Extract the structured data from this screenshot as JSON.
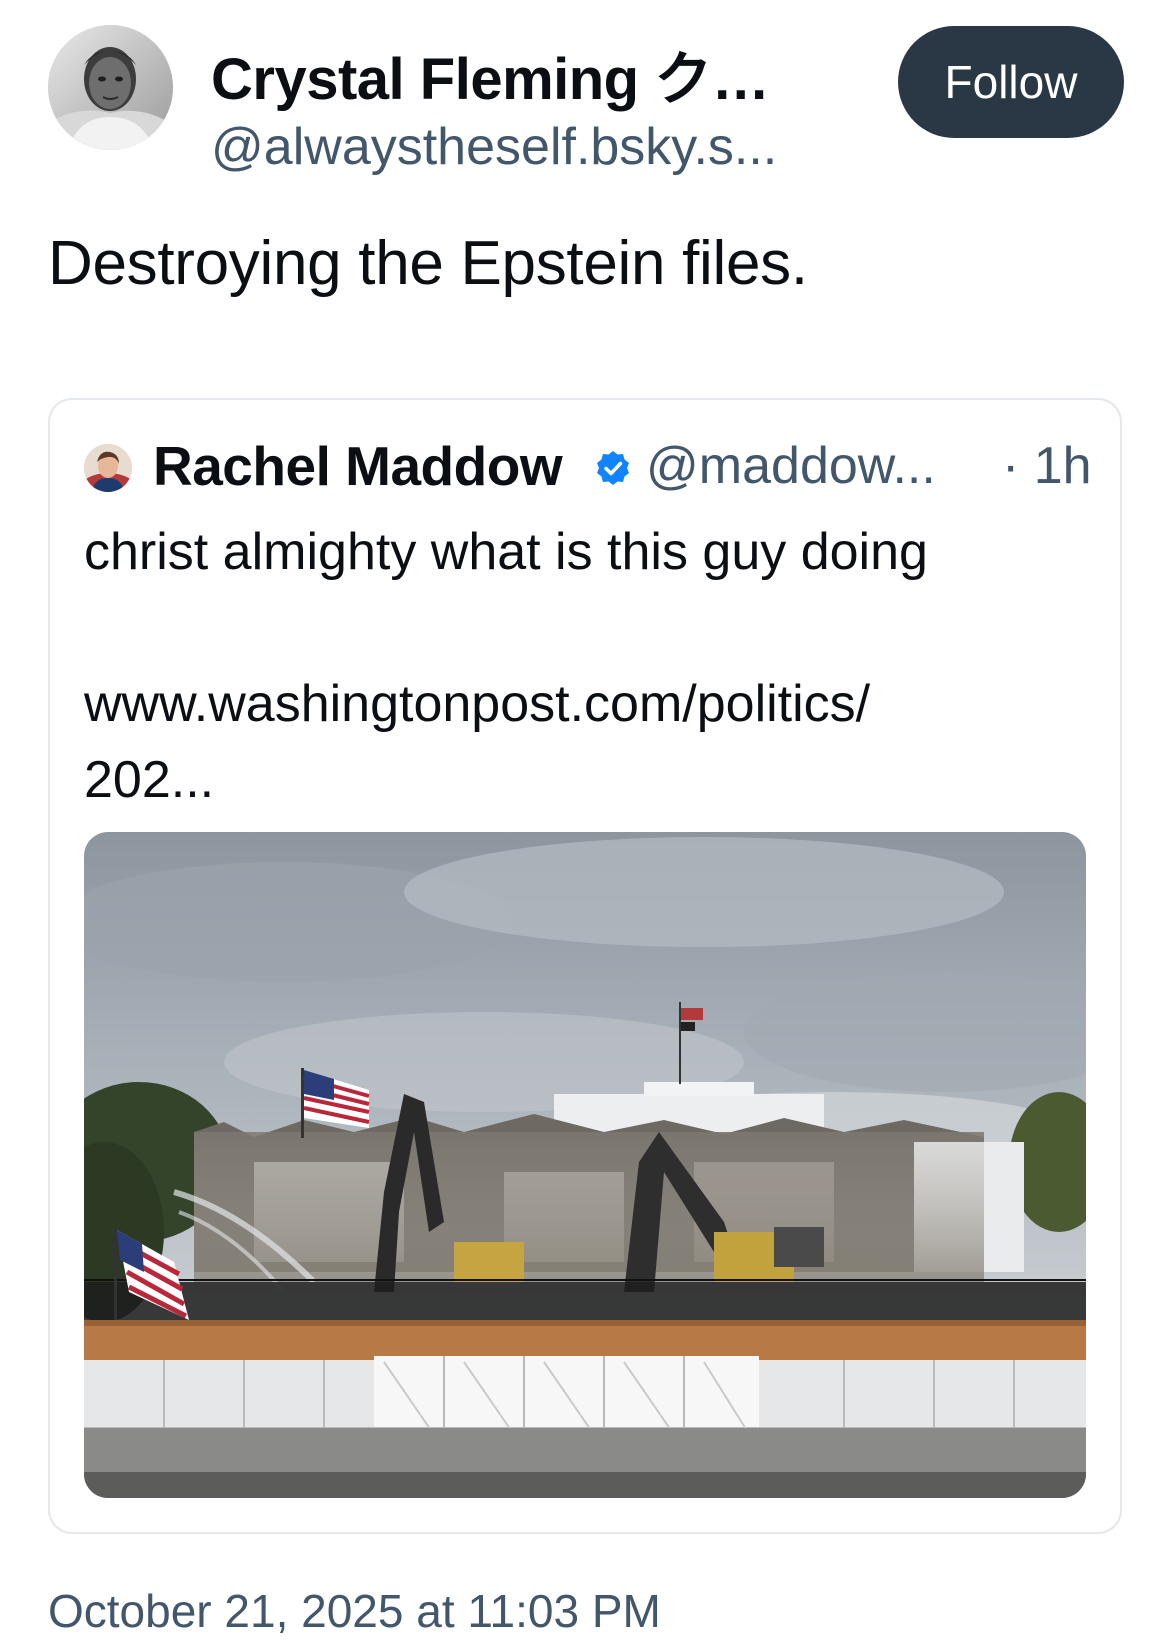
{
  "author": {
    "display_name": "Crystal Fleming ク…",
    "handle": "@alwaystheself.bsky.s...",
    "avatar_icon": "user-avatar-photo"
  },
  "follow_button": {
    "label": "Follow",
    "bg_color": "#2a3845"
  },
  "post": {
    "text": "Destroying the Epstein files."
  },
  "quoted_post": {
    "display_name": "Rachel Maddow",
    "verified_icon": "verified-check-icon",
    "handle": "@maddow...",
    "time": "· 1h",
    "text": "christ almighty what is this guy doing",
    "link": "www.washingtonpost.com/politics/",
    "link_cont": "202...",
    "image_icon": "white-house-demolition-photo"
  },
  "timestamp": "October 21, 2025 at 11:03 PM",
  "colors": {
    "primary_text": "#0b0f14",
    "secondary_text": "#42576c",
    "verified": "#1083fe",
    "border": "#e4e8ec"
  }
}
